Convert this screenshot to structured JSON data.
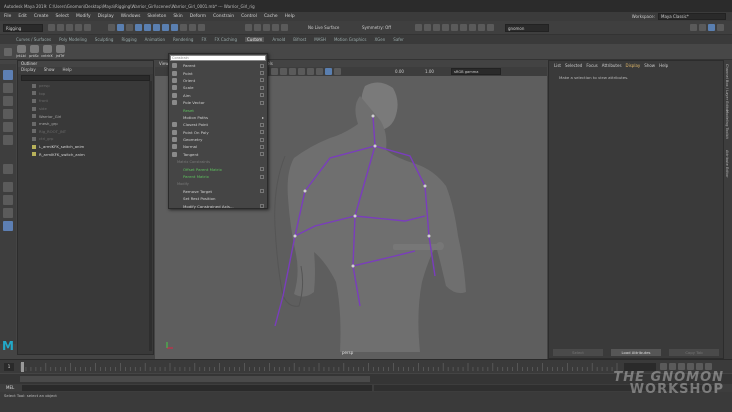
{
  "window": {
    "title": "Autodesk Maya 2019: C:\\Users\\Gnomon\\Desktop\\Maya\\Rigging\\Warrior_Girl\\scenes\\Warrior_Girl_0001.mb*  ---  Warrior_Girl_rig"
  },
  "menubar": [
    "File",
    "Edit",
    "Create",
    "Select",
    "Modify",
    "Display",
    "Windows",
    "Skeleton",
    "Skin",
    "Deform",
    "Constrain",
    "Control",
    "Cache",
    "Help"
  ],
  "workspace": {
    "label": "Workspace:",
    "value": "Maya Classic*"
  },
  "statusline": {
    "mode": "Rigging",
    "live_surface": "No Live Surface",
    "symmetry": "Symmetry: Off",
    "user": "gnomon"
  },
  "shelf_tabs": [
    "Curves / Surfaces",
    "Poly Modeling",
    "Sculpting",
    "Rigging",
    "Animation",
    "Rendering",
    "FX",
    "FX Caching",
    "Custom",
    "Arnold",
    "Bifrost",
    "MASH",
    "Motion Graphics",
    "XGen",
    "Safer"
  ],
  "shelf_active": "Custom",
  "shelf_buttons": [
    "jntLbl",
    "pntSc",
    "cntrlrX",
    "jntTrf",
    "PART"
  ],
  "outliner": {
    "title": "Outliner",
    "menus": [
      "Display",
      "Show",
      "Help"
    ],
    "items": [
      {
        "label": "persp",
        "state": "dim"
      },
      {
        "label": "top",
        "state": "dim"
      },
      {
        "label": "front",
        "state": "dim"
      },
      {
        "label": "side",
        "state": "dim"
      },
      {
        "label": "Warrior_Girl",
        "state": "normal"
      },
      {
        "label": "mesh_grp",
        "state": "normal"
      },
      {
        "label": "Rig_ROOT_JNT",
        "state": "dim"
      },
      {
        "label": "ctrl_grp",
        "state": "dim"
      },
      {
        "label": "L_armIKFK_switch_anim",
        "state": "sel"
      },
      {
        "label": "R_armIKFK_switch_anim",
        "state": "sel"
      }
    ]
  },
  "viewport": {
    "menus": [
      "View",
      "Shading",
      "Lighting",
      "Show",
      "Renderer",
      "Panels"
    ],
    "camera_label": "persp",
    "field_a": "0.00",
    "field_b": "1.00",
    "colorspace": "sRGB gamma"
  },
  "context_menu": {
    "search_placeholder": "Constrain",
    "items": [
      {
        "label": "Parent",
        "type": "item",
        "box": true
      },
      {
        "label": "Point",
        "type": "item",
        "box": true
      },
      {
        "label": "Orient",
        "type": "item",
        "box": true
      },
      {
        "label": "Scale",
        "type": "item",
        "box": true
      },
      {
        "label": "Aim",
        "type": "item",
        "box": true
      },
      {
        "label": "Pole Vector",
        "type": "item",
        "box": true
      },
      {
        "label": "Reset",
        "type": "green"
      },
      {
        "label": "Motion Paths",
        "type": "sub"
      },
      {
        "label": "Closest Point",
        "type": "item",
        "box": true
      },
      {
        "label": "Point On Poly",
        "type": "item",
        "box": true
      },
      {
        "label": "Geometry",
        "type": "item",
        "box": true
      },
      {
        "label": "Normal",
        "type": "item",
        "box": true
      },
      {
        "label": "Tangent",
        "type": "item",
        "box": true
      },
      {
        "label": "Matrix Constraints",
        "type": "hdr"
      },
      {
        "label": "Offset Parent Matrix",
        "type": "green",
        "box": true
      },
      {
        "label": "Parent Matrix",
        "type": "green",
        "box": true
      },
      {
        "label": "Modify",
        "type": "hdr"
      },
      {
        "label": "Remove Target",
        "type": "item",
        "box": true
      },
      {
        "label": "Set Rest Position",
        "type": "item"
      },
      {
        "label": "Modify Constrained Axis...",
        "type": "item",
        "box": true
      }
    ]
  },
  "attribute_editor": {
    "tabs": [
      "List",
      "Selected",
      "Focus",
      "Attributes",
      "Display",
      "Show",
      "Help"
    ],
    "active_tab": "Display",
    "message": "Make a selection to view attributes.",
    "buttons": [
      {
        "label": "Select",
        "enabled": false
      },
      {
        "label": "Load Attributes",
        "enabled": true
      },
      {
        "label": "Copy Tab",
        "enabled": false
      }
    ]
  },
  "side_strip": [
    "Channel Box / Layer Editor",
    "Modeling Toolkit",
    "Attribute Editor"
  ],
  "timeline": {
    "current_frame": "1",
    "end_frame": "120"
  },
  "commandline": {
    "lang": "MEL"
  },
  "helpline": {
    "text": "Select Tool: select an object"
  },
  "watermark": {
    "line1": "THE GNOMON",
    "line2": "WORKSHOP"
  }
}
